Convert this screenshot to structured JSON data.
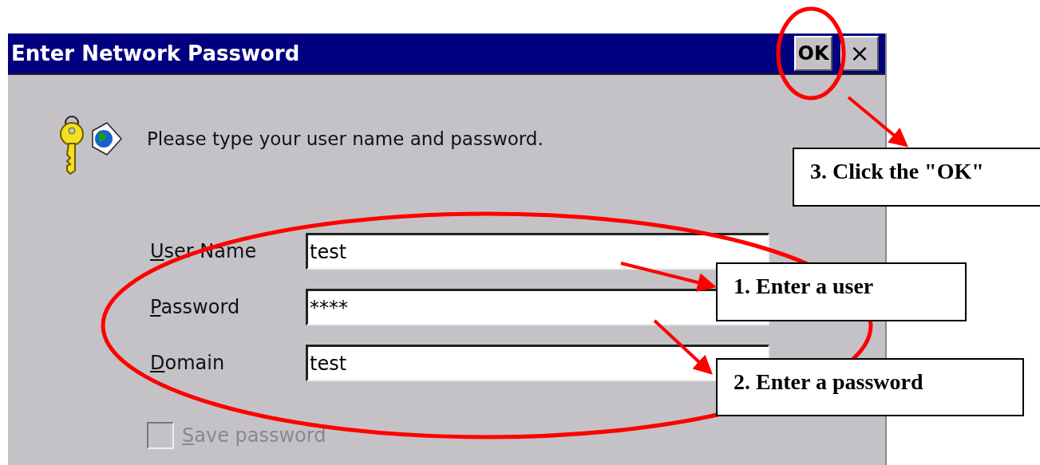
{
  "window": {
    "title": "Enter Network Password"
  },
  "title_buttons": [
    {
      "kind": "ok",
      "label": "OK"
    },
    {
      "kind": "close",
      "label": "×"
    }
  ],
  "prompt": "Please type your user name and password.",
  "fields": [
    {
      "label": "User Name",
      "value": "test"
    },
    {
      "label": "Password",
      "value": "****"
    },
    {
      "label": "Domain",
      "value": "test"
    }
  ],
  "save_password": {
    "label": "Save password",
    "checked": false,
    "disabled": true
  },
  "callouts": [
    {
      "text": "3. Click the \"OK\""
    },
    {
      "text": "1. Enter a user"
    },
    {
      "text": "2. Enter a password"
    }
  ]
}
